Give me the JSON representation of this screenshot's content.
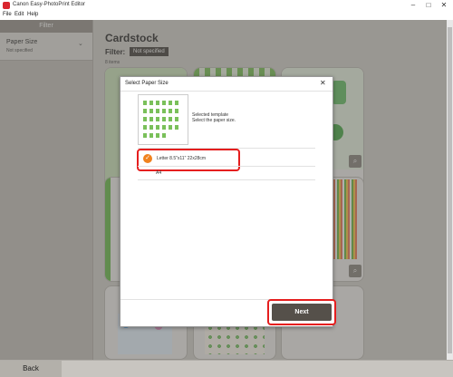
{
  "window": {
    "title": "Canon Easy-PhotoPrint Editor"
  },
  "menu": [
    "File",
    "Edit",
    "Help"
  ],
  "sidebar": {
    "header": "Filter",
    "section_label": "Paper Size",
    "section_value": "Not specified"
  },
  "main": {
    "title": "Cardstock",
    "filter_label": "Filter:",
    "filter_value": "Not specified",
    "count": "8 items"
  },
  "bottom": {
    "back_label": "Back"
  },
  "dialog": {
    "title": "Select Paper Size",
    "selected_line1": "Selected template",
    "selected_line2": "Select the paper size.",
    "options": [
      {
        "label": "Letter 8.5\"x11\" 22x28cm",
        "selected": true
      },
      {
        "label": "A4",
        "selected": false
      }
    ],
    "next_label": "Next"
  },
  "colors": {
    "accent_red": "#e51e1e",
    "check_orange": "#f0821e",
    "next_button": "#55504a"
  }
}
